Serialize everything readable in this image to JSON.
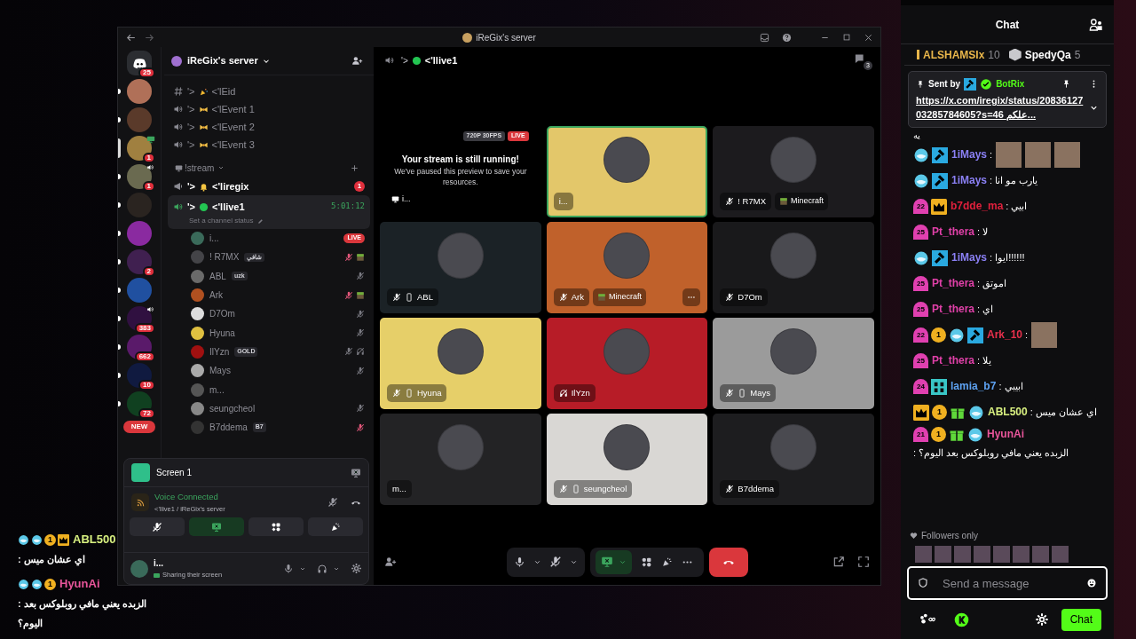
{
  "window": {
    "title": "iReGix's server"
  },
  "servers": [
    {
      "kind": "home",
      "badge": "25",
      "selected": false,
      "unread": false,
      "voice": false,
      "streaming": false
    },
    {
      "kind": "server",
      "selected": false,
      "unread": true,
      "voice": false,
      "streaming": false
    },
    {
      "kind": "server",
      "selected": false,
      "unread": true,
      "voice": false,
      "streaming": false
    },
    {
      "kind": "server",
      "badge": "1",
      "selected": true,
      "unread": false,
      "voice": false,
      "streaming": true
    },
    {
      "kind": "server",
      "badge": "1",
      "selected": false,
      "unread": true,
      "voice": true,
      "streaming": false
    },
    {
      "kind": "server",
      "selected": false,
      "unread": true,
      "voice": false,
      "streaming": false
    },
    {
      "kind": "server",
      "selected": false,
      "unread": true,
      "voice": false,
      "streaming": false
    },
    {
      "kind": "server",
      "badge": "2",
      "selected": false,
      "unread": true,
      "voice": false,
      "streaming": false
    },
    {
      "kind": "server",
      "selected": false,
      "unread": true,
      "voice": false,
      "streaming": false
    },
    {
      "kind": "server",
      "badge": "383",
      "selected": false,
      "unread": true,
      "voice": true,
      "streaming": false
    },
    {
      "kind": "server",
      "badge": "662",
      "selected": false,
      "unread": true,
      "voice": false,
      "streaming": false
    },
    {
      "kind": "server",
      "badge": "10",
      "selected": false,
      "unread": true,
      "voice": false,
      "streaming": false
    },
    {
      "kind": "server",
      "badge": "72",
      "selected": false,
      "unread": true,
      "voice": false,
      "streaming": false
    }
  ],
  "new_badge": "NEW",
  "sidebar": {
    "server_name": "iReGix's server",
    "channels": [
      {
        "kind": "text",
        "prefix": "'˃",
        "emblem": {
          "kind": "party"
        },
        "name": "˂'lEid",
        "unread": false,
        "selected": false
      },
      {
        "kind": "voice",
        "prefix": "'˃",
        "emblem": {
          "kind": "bow"
        },
        "name": "˂'lEvent 1",
        "unread": false,
        "selected": false
      },
      {
        "kind": "voice",
        "prefix": "'˃",
        "emblem": {
          "kind": "bow"
        },
        "name": "˂'lEvent 2",
        "unread": false,
        "selected": false
      },
      {
        "kind": "voice",
        "prefix": "'˃",
        "emblem": {
          "kind": "bow"
        },
        "name": "˂'lEvent 3",
        "unread": false,
        "selected": false
      },
      {
        "kind": "category",
        "name": "!stream"
      },
      {
        "kind": "announce",
        "prefix": "'˃",
        "emblem": {
          "kind": "bell"
        },
        "name": "˂'liregix",
        "badge": "1",
        "unread": true,
        "selected": false
      },
      {
        "kind": "voice",
        "prefix": "'˃",
        "emblem": {
          "kind": "dot"
        },
        "name": "˂'llive1",
        "timer": "5:01:12",
        "status": "Set a channel status",
        "unread": true,
        "selected": true
      }
    ],
    "voice_users": [
      {
        "name": "i...",
        "live_badge": "LIVE",
        "muted": false,
        "deafened": false,
        "server_muted": false,
        "playing": false
      },
      {
        "name": "! R7MX",
        "tag": "شافي",
        "muted": false,
        "deafened": false,
        "server_muted": true,
        "playing": true
      },
      {
        "name": "ABL",
        "tag": "uzk",
        "muted": true,
        "deafened": false,
        "server_muted": false,
        "playing": false
      },
      {
        "name": "Ark",
        "muted": false,
        "deafened": false,
        "server_muted": true,
        "playing": true
      },
      {
        "name": "D7Om",
        "muted": true,
        "deafened": false,
        "server_muted": false,
        "playing": false
      },
      {
        "name": "Hyuna",
        "muted": true,
        "deafened": false,
        "server_muted": false,
        "playing": false
      },
      {
        "name": "IlYzn",
        "tag": "GOLD",
        "muted": true,
        "deafened": true,
        "server_muted": false,
        "playing": false
      },
      {
        "name": "Mays",
        "muted": true,
        "deafened": false,
        "server_muted": false,
        "playing": false
      },
      {
        "name": "m...",
        "muted": false,
        "deafened": false,
        "server_muted": false,
        "playing": false
      },
      {
        "name": "seungcheol",
        "muted": true,
        "deafened": false,
        "server_muted": false,
        "playing": false
      },
      {
        "name": "B7ddema",
        "tag": "B7",
        "muted": false,
        "deafened": false,
        "server_muted": true,
        "playing": false
      }
    ]
  },
  "voice_panel": {
    "stream_title": "Screen 1",
    "status": "Voice Connected",
    "channel": "˂'llive1 / iReGix's server",
    "user": "i...",
    "user_status": "Sharing their screen",
    "screen_share_on": true
  },
  "call": {
    "channel_prefix": "'˃",
    "channel": "˂'llive1",
    "chat_count": "3",
    "tiles": [
      {
        "kind": "stream",
        "quality": "720P 30FPS",
        "live": "LIVE",
        "title": "Your stream is still running!",
        "text": "We've paused this preview to save your resources.",
        "name": "i..."
      },
      {
        "kind": "user",
        "name": "i...",
        "color": "#e3c76a",
        "speaking": true,
        "muted": false,
        "deafened": false,
        "server_muted": false,
        "mobile": false,
        "more": false
      },
      {
        "kind": "user",
        "name": "! R7MX",
        "color": "#1c1b1e",
        "speaking": false,
        "muted": false,
        "deafened": false,
        "server_muted": true,
        "mobile": false,
        "activity": "Minecraft",
        "more": false
      },
      {
        "kind": "user",
        "name": "ABL",
        "color": "#1b2226",
        "speaking": false,
        "muted": true,
        "deafened": false,
        "server_muted": false,
        "mobile": true,
        "more": false
      },
      {
        "kind": "user",
        "name": "Ark",
        "color": "#c0612b",
        "speaking": false,
        "muted": false,
        "deafened": false,
        "server_muted": true,
        "mobile": false,
        "activity": "Minecraft",
        "more": true
      },
      {
        "kind": "user",
        "name": "D7Om",
        "color": "#19191b",
        "speaking": false,
        "muted": true,
        "deafened": false,
        "server_muted": false,
        "mobile": false,
        "more": false
      },
      {
        "kind": "user",
        "name": "Hyuna",
        "color": "#e6cf69",
        "speaking": false,
        "muted": true,
        "deafened": false,
        "server_muted": false,
        "mobile": true,
        "more": false
      },
      {
        "kind": "user",
        "name": "IlYzn",
        "color": "#b71c27",
        "speaking": false,
        "muted": false,
        "deafened": true,
        "server_muted": false,
        "mobile": false,
        "more": false
      },
      {
        "kind": "user",
        "name": "Mays",
        "color": "#9b9b9b",
        "speaking": false,
        "muted": true,
        "deafened": false,
        "server_muted": false,
        "mobile": true,
        "more": false
      },
      {
        "kind": "user",
        "name": "m...",
        "color": "#232325",
        "speaking": false,
        "muted": false,
        "deafened": false,
        "server_muted": false,
        "mobile": false,
        "more": false
      },
      {
        "kind": "user",
        "name": "seungcheol",
        "color": "#d9d7d4",
        "speaking": false,
        "muted": true,
        "deafened": false,
        "server_muted": false,
        "mobile": true,
        "more": false
      },
      {
        "kind": "user",
        "name": "B7ddema",
        "color": "#1d1d1f",
        "speaking": false,
        "muted": false,
        "deafened": false,
        "server_muted": true,
        "mobile": false,
        "more": false
      }
    ],
    "camera_off": true,
    "screen_share_on": true
  },
  "stream_overlay": [
    {
      "badges": [
        {
          "kind": "sub"
        },
        {
          "kind": "sub"
        },
        {
          "kind": "coin",
          "text": "1"
        },
        {
          "kind": "crown"
        }
      ],
      "name": "ABL500",
      "color": "#d8f080",
      "text": " : اي عشان ميس"
    },
    {
      "badges": [
        {
          "kind": "sub"
        },
        {
          "kind": "sub"
        },
        {
          "kind": "coin",
          "text": "1"
        }
      ],
      "name": "HyunAi",
      "color": "#e8559a",
      "text": " : الزبده يعني مافي روبلوكس بعد اليوم؟"
    }
  ],
  "chat": {
    "title": "Chat",
    "leaders": [
      {
        "name": "ALSHAMSIx",
        "count": "10",
        "color": "#e8b54a"
      },
      {
        "name": "SpedyQa",
        "count": "5",
        "color": "#ffffff"
      }
    ],
    "pinned": {
      "label": "Sent by",
      "sender": "BotRix",
      "text": "https://x.com/iregix/status/2083612703285784605?s=46 علكم..."
    },
    "fragment": "يه",
    "messages": [
      {
        "kind": "images",
        "badges": [
          {
            "kind": "sub"
          },
          {
            "kind": "mod"
          }
        ],
        "name": "1iMays",
        "color": "#8b80f5",
        "text": ":",
        "images": [
          {
            "kind": "photo"
          },
          {
            "kind": "photo"
          },
          {
            "kind": "photo"
          }
        ]
      },
      {
        "kind": "text",
        "badges": [
          {
            "kind": "sub"
          },
          {
            "kind": "mod"
          }
        ],
        "name": "1iMays",
        "color": "#8b80f5",
        "text": ": يارب مو انا"
      },
      {
        "kind": "text",
        "badges": [
          {
            "kind": "level",
            "text": "22"
          },
          {
            "kind": "crown"
          }
        ],
        "name": "b7dde_ma",
        "color": "#e0203c",
        "text": ": ابيي"
      },
      {
        "kind": "text",
        "badges": [
          {
            "kind": "level",
            "text": "25"
          }
        ],
        "name": "Pt_thera",
        "color": "#e040a8",
        "text": ": لا"
      },
      {
        "kind": "text",
        "badges": [
          {
            "kind": "sub"
          },
          {
            "kind": "mod"
          }
        ],
        "name": "1iMays",
        "color": "#8b80f5",
        "text": ": ايوا!!!!!!"
      },
      {
        "kind": "text",
        "badges": [
          {
            "kind": "level",
            "text": "25"
          }
        ],
        "name": "Pt_thera",
        "color": "#e040a8",
        "text": ": اموتق"
      },
      {
        "kind": "text",
        "badges": [
          {
            "kind": "level",
            "text": "25"
          }
        ],
        "name": "Pt_thera",
        "color": "#e040a8",
        "text": ": اي"
      },
      {
        "kind": "images",
        "badges": [
          {
            "kind": "level",
            "text": "22"
          },
          {
            "kind": "coin",
            "text": "1"
          },
          {
            "kind": "sub"
          },
          {
            "kind": "mod"
          }
        ],
        "name": "Ark_10",
        "color": "#e8304c",
        "text": ":",
        "images": [
          {
            "kind": "photo"
          }
        ]
      },
      {
        "kind": "text",
        "badges": [
          {
            "kind": "level",
            "text": "25"
          }
        ],
        "name": "Pt_thera",
        "color": "#e040a8",
        "text": ": يلا"
      },
      {
        "kind": "text",
        "badges": [
          {
            "kind": "level",
            "text": "24"
          },
          {
            "kind": "og"
          }
        ],
        "name": "lamia_b7",
        "color": "#5ea2f2",
        "text": ": ابيبي"
      },
      {
        "kind": "text",
        "badges": [
          {
            "kind": "crown"
          },
          {
            "kind": "coin",
            "text": "1"
          },
          {
            "kind": "gift"
          },
          {
            "kind": "sub"
          }
        ],
        "name": "ABL500",
        "color": "#d8f080",
        "text": ": اي عشان ميس"
      },
      {
        "kind": "text",
        "badges": [
          {
            "kind": "level",
            "text": "21"
          },
          {
            "kind": "coin",
            "text": "1"
          },
          {
            "kind": "gift"
          },
          {
            "kind": "sub"
          }
        ],
        "name": "HyunAi",
        "color": "#e8559a",
        "text": ": الزبده يعني مافي روبلوكس بعد اليوم؟"
      }
    ],
    "mode": "Followers only",
    "avatars": [
      {
        "kind": "photo"
      },
      {
        "kind": "photo"
      },
      {
        "kind": "photo"
      },
      {
        "kind": "photo"
      },
      {
        "kind": "photo"
      },
      {
        "kind": "photo"
      },
      {
        "kind": "photo"
      },
      {
        "kind": "photo"
      }
    ],
    "placeholder": "Send a message",
    "send_label": "Chat"
  }
}
